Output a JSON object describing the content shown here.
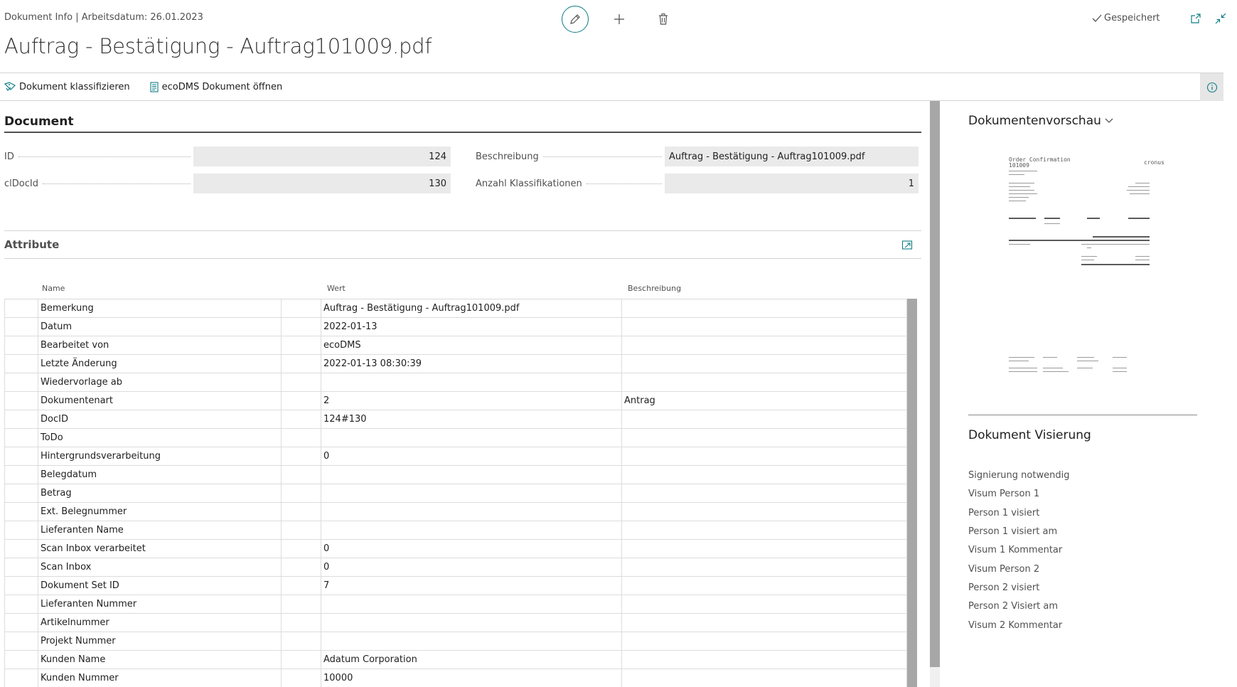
{
  "header": {
    "caption": "Dokument Info | Arbeitsdatum: 26.01.2023",
    "title": "Auftrag - Bestätigung - Auftrag101009.pdf",
    "saved_status": "Gespeichert"
  },
  "icons": {
    "edit": "pencil-icon",
    "add": "plus-icon",
    "delete": "trash-icon",
    "saved": "checkmark-icon",
    "open_new_window": "open-in-new-window-icon",
    "collapse": "collapse-icon",
    "info": "info-icon",
    "classify": "classify-icon",
    "open_document": "document-icon",
    "expand_attributes": "expand-icon",
    "preview_toggle": "chevron-down-icon"
  },
  "actions": {
    "classify_label": "Dokument klassifizieren",
    "open_label": "ecoDMS Dokument öffnen"
  },
  "document": {
    "section_title": "Document",
    "fields": {
      "id": {
        "label": "ID",
        "value": "124"
      },
      "cldocid": {
        "label": "clDocId",
        "value": "130"
      },
      "beschreibung": {
        "label": "Beschreibung",
        "value": "Auftrag - Bestätigung - Auftrag101009.pdf"
      },
      "anzahl": {
        "label": "Anzahl Klassifikationen",
        "value": "1"
      }
    }
  },
  "attributes": {
    "section_title": "Attribute",
    "columns": {
      "name": "Name",
      "wert": "Wert",
      "beschreibung": "Beschreibung"
    },
    "rows": [
      {
        "name": "Bemerkung",
        "wert": "Auftrag - Bestätigung - Auftrag101009.pdf",
        "beschreibung": ""
      },
      {
        "name": "Datum",
        "wert": "2022-01-13",
        "beschreibung": ""
      },
      {
        "name": "Bearbeitet von",
        "wert": "ecoDMS",
        "beschreibung": ""
      },
      {
        "name": "Letzte Änderung",
        "wert": "2022-01-13 08:30:39",
        "beschreibung": ""
      },
      {
        "name": "Wiedervorlage ab",
        "wert": "",
        "beschreibung": ""
      },
      {
        "name": "Dokumentenart",
        "wert": "2",
        "beschreibung": "Antrag"
      },
      {
        "name": "DocID",
        "wert": "124#130",
        "beschreibung": ""
      },
      {
        "name": "ToDo",
        "wert": "",
        "beschreibung": ""
      },
      {
        "name": "Hintergrundsverarbeitung",
        "wert": "0",
        "beschreibung": ""
      },
      {
        "name": "Belegdatum",
        "wert": "",
        "beschreibung": ""
      },
      {
        "name": "Betrag",
        "wert": "",
        "beschreibung": ""
      },
      {
        "name": "Ext. Belegnummer",
        "wert": "",
        "beschreibung": ""
      },
      {
        "name": "Lieferanten Name",
        "wert": "",
        "beschreibung": ""
      },
      {
        "name": "Scan Inbox verarbeitet",
        "wert": "0",
        "beschreibung": ""
      },
      {
        "name": "Scan Inbox",
        "wert": "0",
        "beschreibung": ""
      },
      {
        "name": "Dokument Set ID",
        "wert": "7",
        "beschreibung": ""
      },
      {
        "name": "Lieferanten Nummer",
        "wert": "",
        "beschreibung": ""
      },
      {
        "name": "Artikelnummer",
        "wert": "",
        "beschreibung": ""
      },
      {
        "name": "Projekt Nummer",
        "wert": "",
        "beschreibung": ""
      },
      {
        "name": "Kunden Name",
        "wert": "Adatum Corporation",
        "beschreibung": ""
      },
      {
        "name": "Kunden Nummer",
        "wert": "10000",
        "beschreibung": ""
      }
    ]
  },
  "factbox": {
    "preview_title": "Dokumentenvorschau",
    "preview_doc": {
      "heading": "Order Confirmation",
      "number": "101009",
      "logo": "cronus"
    },
    "visierung_title": "Dokument Visierung",
    "visierung_items": [
      "Signierung notwendig",
      "Visum Person 1",
      "Person 1 visiert",
      "Person 1 visiert am",
      "Visum 1 Kommentar",
      "Visum Person 2",
      "Person 2 visiert",
      "Person 2 Visiert am",
      "Visum 2 Kommentar"
    ]
  },
  "colors": {
    "accent": "#0e7c86",
    "field_bg": "#eaeaea",
    "scrollbar": "#a7a7a7"
  }
}
